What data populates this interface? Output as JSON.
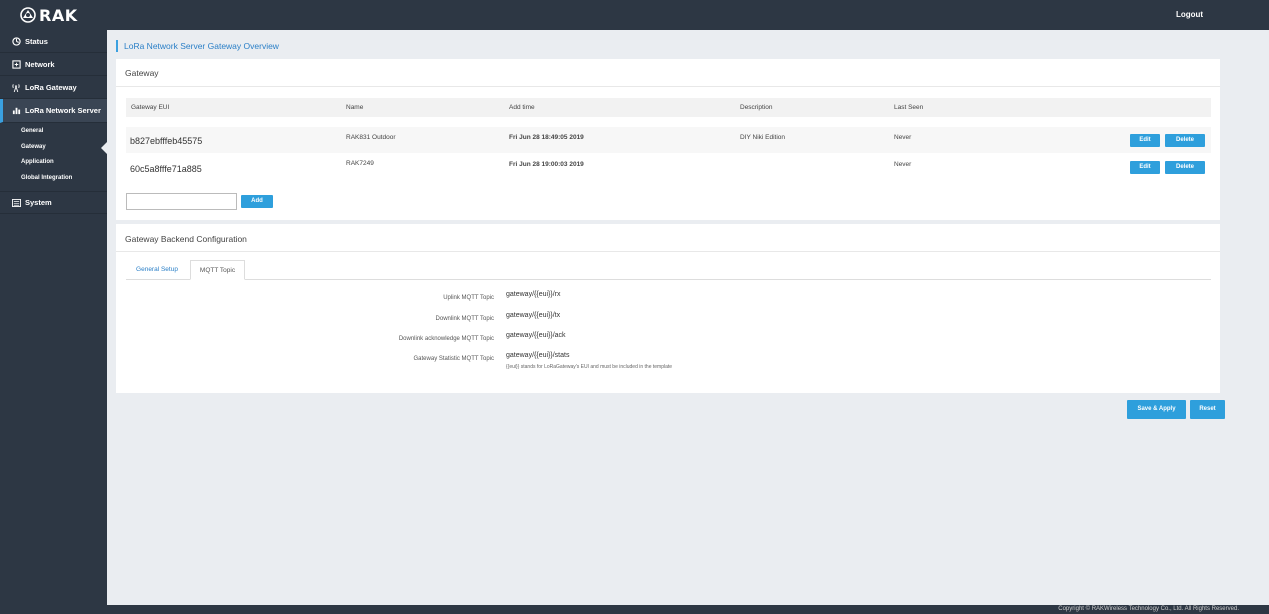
{
  "header": {
    "brand": "RAK",
    "logout_label": "Logout"
  },
  "sidebar": {
    "items": [
      {
        "label": "Status",
        "icon": "status-icon"
      },
      {
        "label": "Network",
        "icon": "network-icon"
      },
      {
        "label": "LoRa Gateway",
        "icon": "antenna-icon"
      },
      {
        "label": "LoRa Network Server",
        "icon": "bar-chart-icon"
      },
      {
        "label": "System",
        "icon": "system-icon"
      }
    ],
    "subitems": [
      "General",
      "Gateway",
      "Application",
      "Global Integration"
    ],
    "active_item": "LoRa Network Server",
    "active_subitem": "Gateway"
  },
  "page": {
    "title": "LoRa Network Server Gateway Overview"
  },
  "gateway_panel": {
    "title": "Gateway",
    "columns": [
      "Gateway EUI",
      "Name",
      "Add time",
      "Description",
      "Last Seen"
    ],
    "rows": [
      {
        "eui": "b827ebfffeb45575",
        "name": "RAK831 Outdoor",
        "add_time": "Fri Jun 28 18:49:05 2019",
        "description": "DIY Niki Edition",
        "last_seen": "Never"
      },
      {
        "eui": "60c5a8fffe71a885",
        "name": "RAK7249",
        "add_time": "Fri Jun 28 19:00:03 2019",
        "description": "",
        "last_seen": "Never"
      }
    ],
    "edit_label": "Edit",
    "delete_label": "Delete",
    "new_eui_value": "",
    "add_label": "Add"
  },
  "backend_panel": {
    "title": "Gateway Backend Configuration",
    "tabs": [
      "General Setup",
      "MQTT Topic"
    ],
    "active_tab": "MQTT Topic",
    "fields": [
      {
        "label": "Uplink MQTT Topic",
        "value": "gateway/{{eui}}/rx"
      },
      {
        "label": "Downlink MQTT Topic",
        "value": "gateway/{{eui}}/tx"
      },
      {
        "label": "Downlink acknowledge MQTT Topic",
        "value": "gateway/{{eui}}/ack"
      },
      {
        "label": "Gateway Statistic MQTT Topic",
        "value": "gateway/{{eui}}/stats"
      }
    ],
    "help_text": "{{eui}} stands for LoRaGateway's EUI and must be included in the template"
  },
  "actions": {
    "save_apply_label": "Save & Apply",
    "reset_label": "Reset"
  },
  "footer": {
    "copyright": "Copyright © RAKWireless Technology Co., Ltd. All Rights Reserved."
  },
  "colors": {
    "nav_bg": "#2d3744",
    "accent": "#2e9fdc",
    "page_bg": "#eaedf1"
  }
}
